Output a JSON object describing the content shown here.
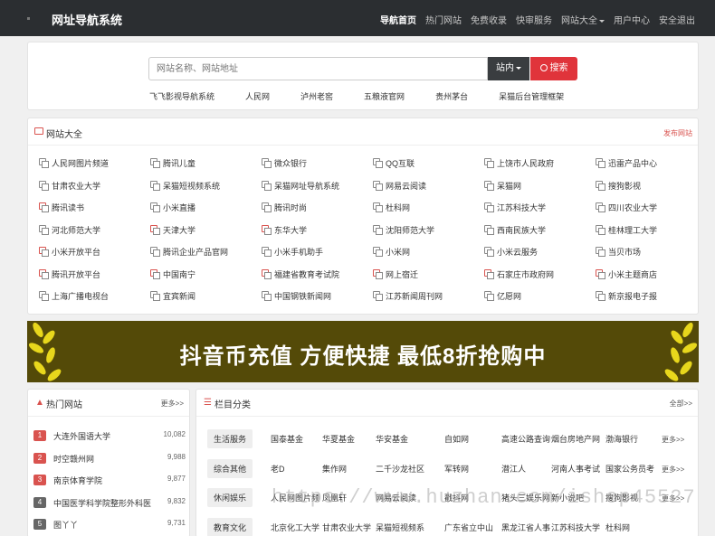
{
  "header": {
    "brand": "网址导航系统",
    "nav": [
      {
        "label": "导航首页",
        "active": true
      },
      {
        "label": "热门网站"
      },
      {
        "label": "免费收录"
      },
      {
        "label": "快审服务"
      },
      {
        "label": "网站大全",
        "dropdown": true
      },
      {
        "label": "用户中心"
      },
      {
        "label": "安全退出"
      }
    ]
  },
  "search": {
    "placeholder": "网站名称、网站地址",
    "scope_label": "站内",
    "button_label": "搜索",
    "quick_links": [
      "飞飞影视导航系统",
      "人民网",
      "泸州老窖",
      "五粮液官网",
      "贵州茅台",
      "呆猫后台管理框架"
    ]
  },
  "sites": {
    "title": "网站大全",
    "action": "发布网站",
    "items": [
      [
        "人民网图片频道",
        "腾讯儿童",
        "微众银行",
        "QQ互联",
        "上饶市人民政府",
        "迅雷产品中心"
      ],
      [
        "甘肃农业大学",
        "呆猫短视频系统",
        "呆猫网址导航系统",
        "网易云阅读",
        "呆猫网",
        "搜狗影视"
      ],
      [
        "腾讯读书",
        "小米直播",
        "腾讯时尚",
        "杜科网",
        "江苏科技大学",
        "四川农业大学"
      ],
      [
        "河北师范大学",
        "天津大学",
        "东华大学",
        "沈阳师范大学",
        "西南民族大学",
        "桂林理工大学"
      ],
      [
        "小米开放平台",
        "腾讯企业产品官网",
        "小米手机助手",
        "小米网",
        "小米云服务",
        "当贝市场"
      ],
      [
        "腾讯开放平台",
        "中国南宁",
        "福建省教育考试院",
        "网上宿迁",
        "石家庄市政府网",
        "小米主题商店"
      ],
      [
        "上海广播电视台",
        "宜宾新闻",
        "中国钢铁新闻网",
        "江苏新闻周刊网",
        "亿愿网",
        "新京报电子报"
      ]
    ],
    "red_icons": [
      [
        3,
        1
      ],
      [
        2,
        0
      ],
      [
        3,
        2
      ],
      [
        4,
        0
      ],
      [
        5,
        0
      ],
      [
        5,
        1
      ],
      [
        5,
        2
      ],
      [
        5,
        3
      ],
      [
        5,
        4
      ],
      [
        5,
        5
      ]
    ]
  },
  "banner": {
    "text": "抖音币充值 方便快捷 最低8折抢购中"
  },
  "hot": {
    "title": "热门网站",
    "more": "更多>>",
    "items": [
      {
        "rank": "1",
        "name": "大连外国语大学",
        "value": "10,082",
        "color": "#d9534f"
      },
      {
        "rank": "2",
        "name": "时空赣州网",
        "value": "9,988",
        "color": "#d9534f"
      },
      {
        "rank": "3",
        "name": "南京体育学院",
        "value": "9,877",
        "color": "#d9534f"
      },
      {
        "rank": "4",
        "name": "中国医学科学院整形外科医",
        "value": "9,832",
        "color": "#666666"
      },
      {
        "rank": "5",
        "name": "图丫丫",
        "value": "9,731",
        "color": "#666666"
      }
    ]
  },
  "categories": {
    "title": "栏目分类",
    "more": "全部>>",
    "rows": [
      {
        "label": "生活服务",
        "items": [
          "国泰基金",
          "华夏基金",
          "华安基金",
          "自如网",
          "高速公路查询",
          "烟台房地产网",
          "渤海银行"
        ],
        "more": "更多>>"
      },
      {
        "label": "综合其他",
        "items": [
          "老D",
          "集作网",
          "二千沙龙社区",
          "军转网",
          "潜江人",
          "河南人事考试",
          "国家公务员考"
        ],
        "more": "更多>>"
      },
      {
        "label": "休闲娱乐",
        "items": [
          "人民网图片频",
          "凤凰轩",
          "网易云阅读",
          "戳抖网",
          "猪头三娱乐网",
          "新小说吧",
          "搜狗影视"
        ],
        "more": "更多>>"
      },
      {
        "label": "教育文化",
        "items": [
          "北京化工大学",
          "甘肃农业大学",
          "呆猫短视频系",
          "广东省立中山",
          "黑龙江省人事",
          "江苏科技大学",
          "杜科网"
        ],
        "more": ""
      }
    ]
  },
  "watermark": "https://www.huzhan.com/ishop45527",
  "colors": {
    "topbar": "#2b2e31",
    "accent": "#e0343b",
    "banner_bg": "#544a08"
  }
}
